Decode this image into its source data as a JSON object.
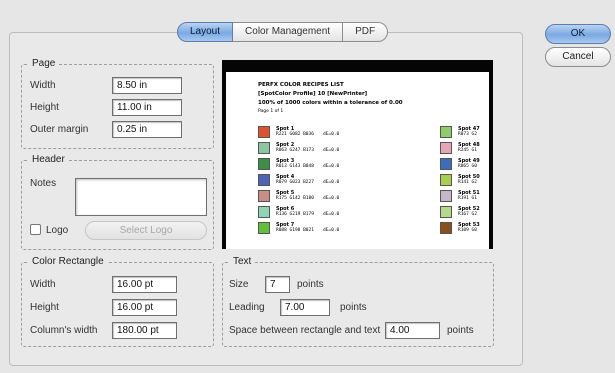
{
  "tabs": [
    {
      "label": "Layout",
      "active": true
    },
    {
      "label": "Color Management",
      "active": false
    },
    {
      "label": "PDF",
      "active": false
    }
  ],
  "buttons": {
    "ok": "OK",
    "cancel": "Cancel"
  },
  "page": {
    "legend": "Page",
    "width_label": "Width",
    "width_value": "8.50 in",
    "height_label": "Height",
    "height_value": "11.00 in",
    "margin_label": "Outer margin",
    "margin_value": "0.25 in"
  },
  "header": {
    "legend": "Header",
    "notes_label": "Notes",
    "notes_value": "",
    "logo_label": "Logo",
    "logo_checked": false,
    "select_logo_label": "Select Logo"
  },
  "color_rectangle": {
    "legend": "Color Rectangle",
    "width_label": "Width",
    "width_value": "16.00 pt",
    "height_label": "Height",
    "height_value": "16.00 pt",
    "column_label": "Column's width",
    "column_value": "180.00 pt"
  },
  "text": {
    "legend": "Text",
    "size_label": "Size",
    "size_value": "7",
    "size_unit": "points",
    "leading_label": "Leading",
    "leading_value": "7.00",
    "leading_unit": "points",
    "space_label": "Space between rectangle and text",
    "space_value": "4.00",
    "space_unit": "points"
  },
  "preview": {
    "title_line1": "PERFX COLOR RECIPES LIST",
    "title_line2": "[SpotColor Profile] 10 [NewPrinter]",
    "title_line3": "100% of 1000 colors within a tolerance of 0.00",
    "page_label": "Page 1 of 1",
    "left_spots": [
      {
        "name": "Spot 1",
        "info": "R221 G082 B036",
        "de": "dE=0.0",
        "color": "#dd5230"
      },
      {
        "name": "Spot 2",
        "info": "R063 G247 B173",
        "de": "dE=0.0",
        "color": "#8ec6a4"
      },
      {
        "name": "Spot 3",
        "info": "R013 G143 B048",
        "de": "dE=0.0",
        "color": "#3b8f44"
      },
      {
        "name": "Spot 4",
        "info": "R079 G023 B227",
        "de": "dE=0.0",
        "color": "#4f63b8"
      },
      {
        "name": "Spot 5",
        "info": "R175 G142 B180",
        "de": "dE=0.0",
        "color": "#c98f86"
      },
      {
        "name": "Spot 6",
        "info": "R136 G219 B179",
        "de": "dE=0.0",
        "color": "#8fd4b4"
      },
      {
        "name": "Spot 7",
        "info": "R088 G198 B021",
        "de": "dE=0.0",
        "color": "#5fbf3a"
      }
    ],
    "right_spots": [
      {
        "name": "Spot 47",
        "info": "R073 G2",
        "color": "#8ecb6a"
      },
      {
        "name": "Spot 48",
        "info": "R245 G1",
        "color": "#e7a6b6"
      },
      {
        "name": "Spot 49",
        "info": "R065 G0",
        "color": "#3c6db8"
      },
      {
        "name": "Spot 50",
        "info": "R141 G2",
        "color": "#a8cf52"
      },
      {
        "name": "Spot 51",
        "info": "R191 G1",
        "color": "#c2b8c9"
      },
      {
        "name": "Spot 52",
        "info": "R167 G2",
        "color": "#b4d98a"
      },
      {
        "name": "Spot 53",
        "info": "R109 G0",
        "color": "#8a4e1c"
      }
    ]
  }
}
